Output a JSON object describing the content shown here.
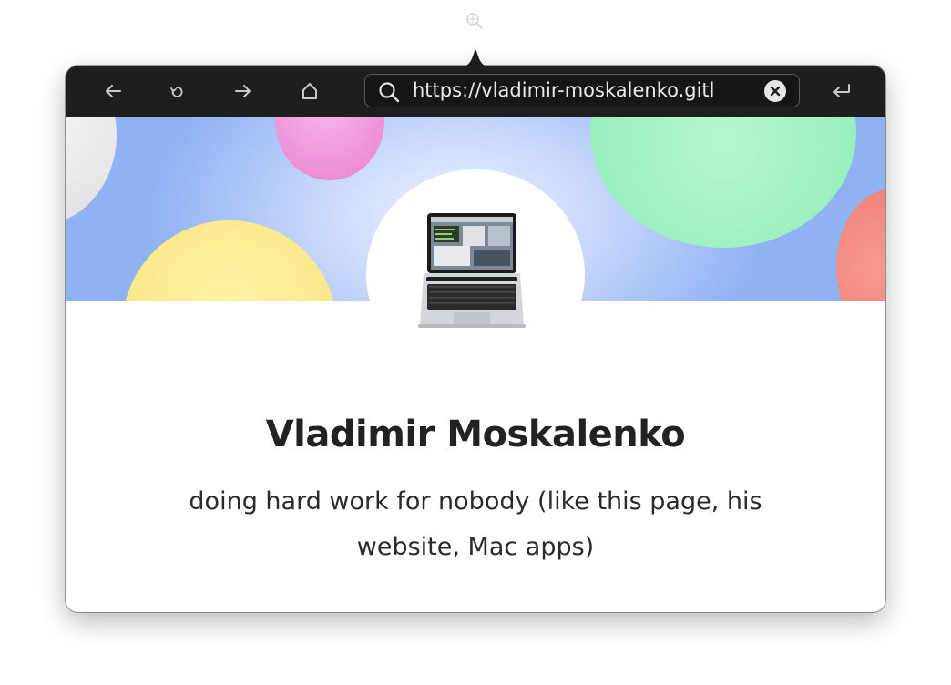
{
  "menubar": {
    "icon": "globe-zoom-icon"
  },
  "toolbar": {
    "back_icon": "arrow-left-icon",
    "reload_icon": "reload-icon",
    "forward_icon": "arrow-right-icon",
    "home_icon": "home-icon",
    "go_icon": "return-icon",
    "url": "https://vladimir-moskalenko.github.io",
    "url_visible": "https://vladimir-moskalenko.gitl"
  },
  "profile": {
    "name": "Vladimir Moskalenko",
    "bio": "doing hard work for nobody (like this page, his website, Mac apps)"
  },
  "colors": {
    "toolbar_bg": "#1e1e1e",
    "hero_blue": "#8fb2f3",
    "text": "#222222"
  }
}
